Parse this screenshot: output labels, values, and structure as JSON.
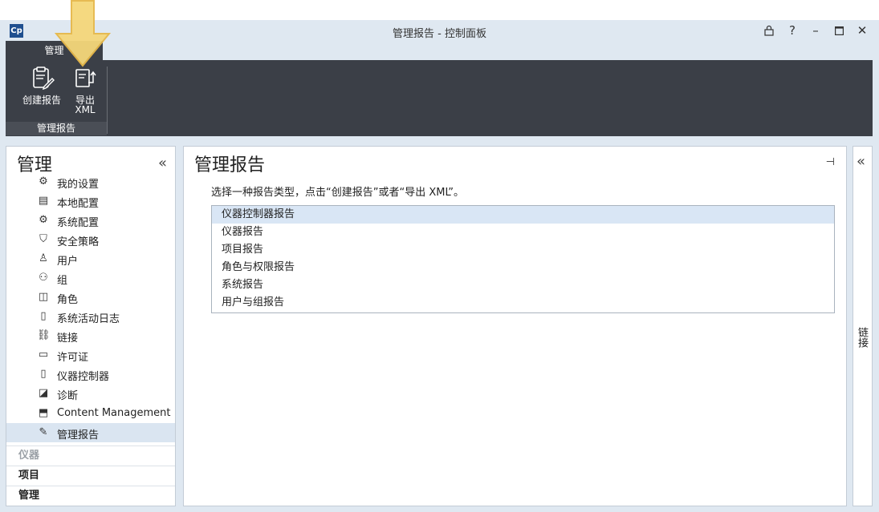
{
  "window": {
    "title": "管理报告 - 控制面板",
    "logo_text": "Cp",
    "controls": {
      "lock": "🔒",
      "help": "?",
      "minimize": "–",
      "maximize": "☐",
      "close": "✕"
    }
  },
  "ribbon": {
    "tab": "管理",
    "buttons": [
      {
        "label": "创建报告",
        "icon": "create-report-icon"
      },
      {
        "label": "导出\nXML",
        "label_line1": "导出",
        "label_line2": "XML",
        "icon": "export-xml-icon"
      }
    ],
    "group_label": "管理报告"
  },
  "sidebar": {
    "title": "管理",
    "collapse_glyph": "«",
    "items": [
      {
        "label": "我的设置",
        "icon": "my-settings-icon",
        "glyph": "⚙"
      },
      {
        "label": "本地配置",
        "icon": "local-config-icon",
        "glyph": "▤"
      },
      {
        "label": "系统配置",
        "icon": "system-config-icon",
        "glyph": "⚙"
      },
      {
        "label": "安全策略",
        "icon": "shield-icon",
        "glyph": "⛉"
      },
      {
        "label": "用户",
        "icon": "user-icon",
        "glyph": "♙"
      },
      {
        "label": "组",
        "icon": "group-icon",
        "glyph": "⚇"
      },
      {
        "label": "角色",
        "icon": "role-icon",
        "glyph": "◫"
      },
      {
        "label": "系统活动日志",
        "icon": "activity-log-icon",
        "glyph": "▯"
      },
      {
        "label": "链接",
        "icon": "link-icon",
        "glyph": "⛓"
      },
      {
        "label": "许可证",
        "icon": "license-icon",
        "glyph": "▭"
      },
      {
        "label": "仪器控制器",
        "icon": "instrument-controller-icon",
        "glyph": "▯"
      },
      {
        "label": "诊断",
        "icon": "diagnostics-icon",
        "glyph": "◪"
      },
      {
        "label": "Content Management",
        "icon": "content-management-icon",
        "glyph": "⬒"
      },
      {
        "label": "管理报告",
        "icon": "admin-report-icon",
        "glyph": "✎",
        "selected": true
      }
    ],
    "sections": [
      {
        "label": "仪器",
        "dim": true
      },
      {
        "label": "项目",
        "dim": false
      },
      {
        "label": "管理",
        "dim": false
      }
    ]
  },
  "main": {
    "title": "管理报告",
    "pin_glyph": "⊣",
    "instruction": "选择一种报告类型，点击“创建报告”或者“导出 XML”。",
    "report_types": [
      {
        "label": "仪器控制器报告",
        "selected": true
      },
      {
        "label": "仪器报告",
        "selected": false
      },
      {
        "label": "项目报告",
        "selected": false
      },
      {
        "label": "角色与权限报告",
        "selected": false
      },
      {
        "label": "系统报告",
        "selected": false
      },
      {
        "label": "用户与组报告",
        "selected": false
      }
    ]
  },
  "right_panel": {
    "collapse_glyph": "«",
    "label": "链接"
  },
  "colors": {
    "ribbon_bg": "#3b3f47",
    "chrome_bg": "#dfe8f1",
    "selection_bg": "#dae5f1",
    "arrow_fill": "#f5d77a",
    "arrow_stroke": "#e6b84a"
  }
}
